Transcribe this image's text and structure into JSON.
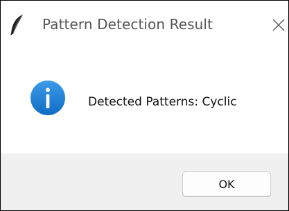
{
  "window": {
    "title": "Pattern Detection Result",
    "app_icon": "feather-icon",
    "close_icon": "close-icon"
  },
  "message": {
    "icon": "info-icon",
    "text": "Detected Patterns: Cyclic"
  },
  "buttons": {
    "ok_label": "OK"
  },
  "colors": {
    "info_icon": "#1a7fd8",
    "footer_background": "#f0f0f0",
    "title_text": "#555555"
  }
}
